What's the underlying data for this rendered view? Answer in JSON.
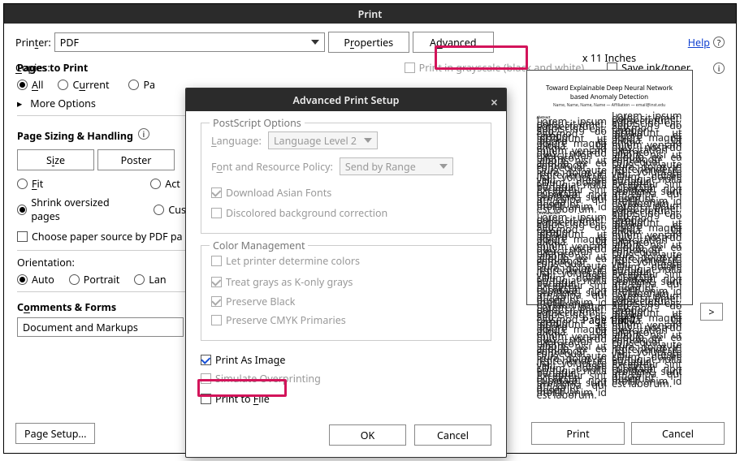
{
  "print": {
    "title": "Print",
    "printer_lbl": "Printer:",
    "printer_val": "PDF",
    "properties_btn": "Properties",
    "advanced_btn": "Advanced",
    "help": "Help",
    "copies_lbl": "Copies:",
    "grayscale": "Print in grayscale (black and white)",
    "saveink": "Save ink/toner",
    "pages_to_print": "Pages to Print",
    "all": "All",
    "current": "Current",
    "pages": "Pa",
    "more_options": "More Options",
    "page_sizing": "Page Sizing & Handling",
    "size": "Size",
    "poster": "Poster",
    "fit": "Fit",
    "actual": "Act",
    "shrink": "Shrink oversized pages",
    "custom": "Cus",
    "choose_paper": "Choose paper source by PDF pa",
    "orientation_lbl": "Orientation:",
    "auto": "Auto",
    "portrait": "Portrait",
    "landscape": "Lan",
    "comments_forms": "Comments & Forms",
    "comments_val": "Document and Markups",
    "preview_dims": "x 11 Inches",
    "pager": "Page 1 of 7",
    "next": ">",
    "page_setup": "Page Setup...",
    "print_btn": "Print",
    "cancel_btn": "Cancel"
  },
  "preview": {
    "title": "Toward Explainable Deep Neural Network based Anomaly Detection",
    "authors": "Name, Name, Name, Name — Affiliation — email@inst.edu",
    "abshead": "Abstract",
    "introhead": "1  Introduction",
    "fill": "Lorem ipsum dolor sit amet, consectetur adipiscing elit. Sed do eiusmod tempor incididunt ut labore et dolore magna aliqua. Ut enim ad minim veniam quis nostrud exercitation ullamco laboris nisi ut aliquip ex ea commodo consequat. Duis aute irure dolor in reprehenderit in voluptate velit esse cillum dolore eu fugiat nulla pariatur. Excepteur sint occaecat cupidatat non proident, sunt in culpa qui officia deserunt mollit anim id est laborum."
  },
  "adv": {
    "title": "Advanced Print Setup",
    "ps_legend": "PostScript Options",
    "lang_lbl": "Language:",
    "lang_val": "Language Level 2",
    "policy_lbl": "Font and Resource Policy:",
    "policy_val": "Send by Range",
    "dl_asian": "Download Asian Fonts",
    "discolor": "Discolored background correction",
    "cm_legend": "Color Management",
    "let_printer": "Let printer determine colors",
    "treat_gray": "Treat grays as K-only grays",
    "preserve_black": "Preserve Black",
    "preserve_cmyk": "Preserve CMYK Primaries",
    "print_image": "Print As Image",
    "sim_over": "Simulate Overprinting",
    "print_file": "Print to File",
    "ok": "OK",
    "cancel": "Cancel"
  }
}
